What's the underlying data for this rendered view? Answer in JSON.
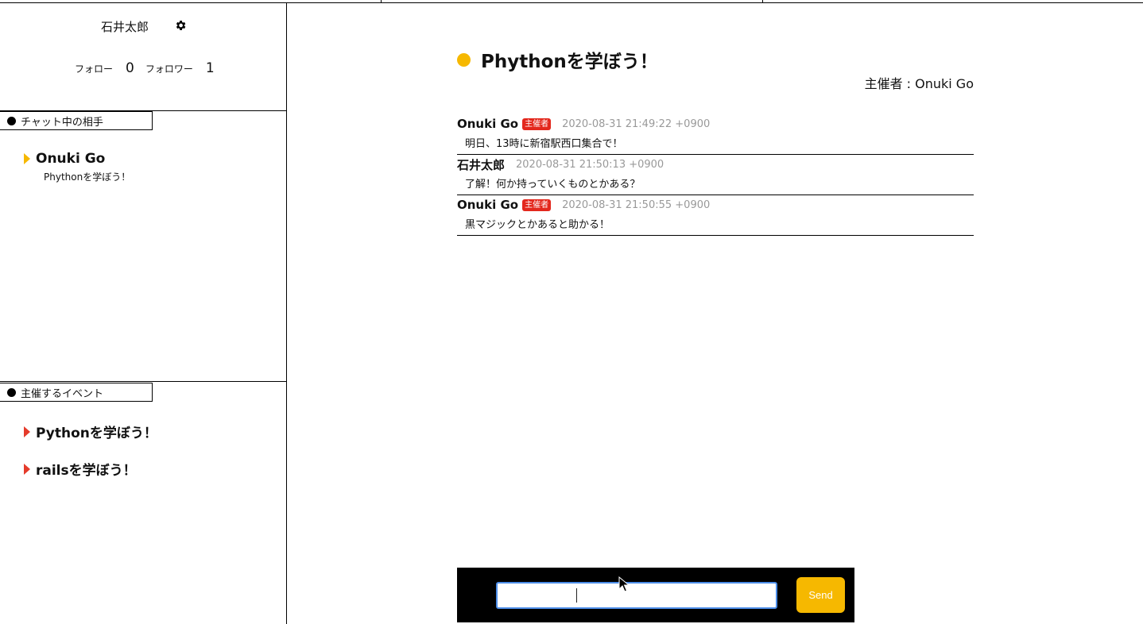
{
  "sidebar": {
    "user_name": "石井太郎",
    "settings_icon": "gear-icon",
    "follow_label": "フォロー",
    "follow_count": "0",
    "follower_label": "フォロワー",
    "follower_count": "1",
    "chat_section_label": "チャット中の相手",
    "chats": [
      {
        "name": "Onuki Go",
        "event": "Phythonを学ぼう！"
      }
    ],
    "events_section_label": "主催するイベント",
    "events": [
      {
        "title": "Pythonを学ぼう！"
      },
      {
        "title": "railsを学ぼう！"
      }
    ]
  },
  "main": {
    "event_title": "Phythonを学ぼう！",
    "organizer": "主催者 : Onuki Go",
    "host_badge": "主催者",
    "messages": [
      {
        "author": "Onuki Go",
        "is_host": true,
        "time": "2020-08-31 21:49:22 +0900",
        "body": "明日、13時に新宿駅西口集合で！"
      },
      {
        "author": "石井太郎",
        "is_host": false,
        "time": "2020-08-31 21:50:13 +0900",
        "body": "了解！何か持っていくものとかある？"
      },
      {
        "author": "Onuki Go",
        "is_host": true,
        "time": "2020-08-31 21:50:55 +0900",
        "body": "黒マジックとかあると助かる！"
      }
    ],
    "composer": {
      "input_value": "",
      "send_label": "Send"
    }
  },
  "colors": {
    "accent_yellow": "#f6b800",
    "accent_red": "#e53b2b",
    "input_focus": "#4c8de8"
  }
}
